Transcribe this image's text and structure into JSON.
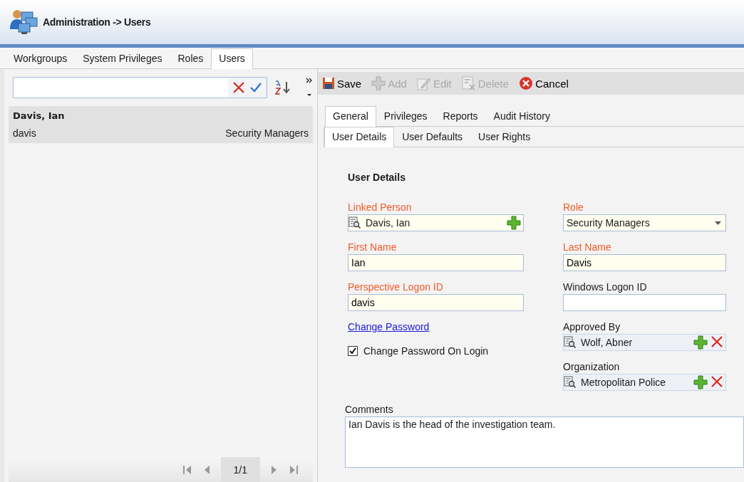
{
  "window": {
    "title": "Administration -> Users"
  },
  "main_tabs": [
    {
      "label": "Workgroups",
      "selected": false
    },
    {
      "label": "System Privileges",
      "selected": false
    },
    {
      "label": "Roles",
      "selected": false
    },
    {
      "label": "Users",
      "selected": true
    }
  ],
  "list": {
    "items": [
      {
        "name": "Davis, Ian",
        "login": "davis",
        "role": "Security Managers",
        "selected": true
      }
    ]
  },
  "pager": {
    "page": "1/1"
  },
  "toolbar": [
    {
      "kind": "save",
      "label": "Save",
      "disabled": false
    },
    {
      "kind": "add",
      "label": "Add",
      "disabled": true
    },
    {
      "kind": "edit",
      "label": "Edit",
      "disabled": true
    },
    {
      "kind": "delete",
      "label": "Delete",
      "disabled": true
    },
    {
      "kind": "cancel",
      "label": "Cancel",
      "disabled": false
    }
  ],
  "detail_tabs": [
    {
      "label": "General",
      "selected": true
    },
    {
      "label": "Privileges",
      "selected": false
    },
    {
      "label": "Reports",
      "selected": false
    },
    {
      "label": "Audit History",
      "selected": false
    }
  ],
  "sub_tabs": [
    {
      "label": "User Details",
      "selected": true
    },
    {
      "label": "User Defaults",
      "selected": false
    },
    {
      "label": "User Rights",
      "selected": false
    }
  ],
  "section_title": "User Details",
  "left_fields": [
    {
      "kind": "lookup",
      "label": "Linked Person",
      "value": "Davis, Ian",
      "required": true,
      "add": true,
      "remove": false
    },
    {
      "kind": "text",
      "label": "First Name",
      "value": "Ian",
      "required": true
    },
    {
      "kind": "text",
      "label": "Perspective Logon ID",
      "value": "davis",
      "required": true
    },
    {
      "kind": "link",
      "label": "Change Password"
    },
    {
      "kind": "checkbox",
      "label": "Change Password On Login",
      "checked": true
    }
  ],
  "right_fields": [
    {
      "kind": "dropdown",
      "label": "Role",
      "value": "Security Managers",
      "required": true
    },
    {
      "kind": "text",
      "label": "Last Name",
      "value": "Davis",
      "required": true
    },
    {
      "kind": "text",
      "label": "Windows Logon ID",
      "required": false
    },
    {
      "kind": "lookup",
      "label": "Approved By",
      "value": "Wolf, Abner",
      "required": false,
      "add": true,
      "remove": true
    },
    {
      "kind": "lookup",
      "label": "Organization",
      "value": "Metropolitan Police",
      "required": false,
      "add": true,
      "remove": true
    }
  ],
  "comments": {
    "label": "Comments",
    "value": "Ian Davis is the head of the investigation team."
  }
}
